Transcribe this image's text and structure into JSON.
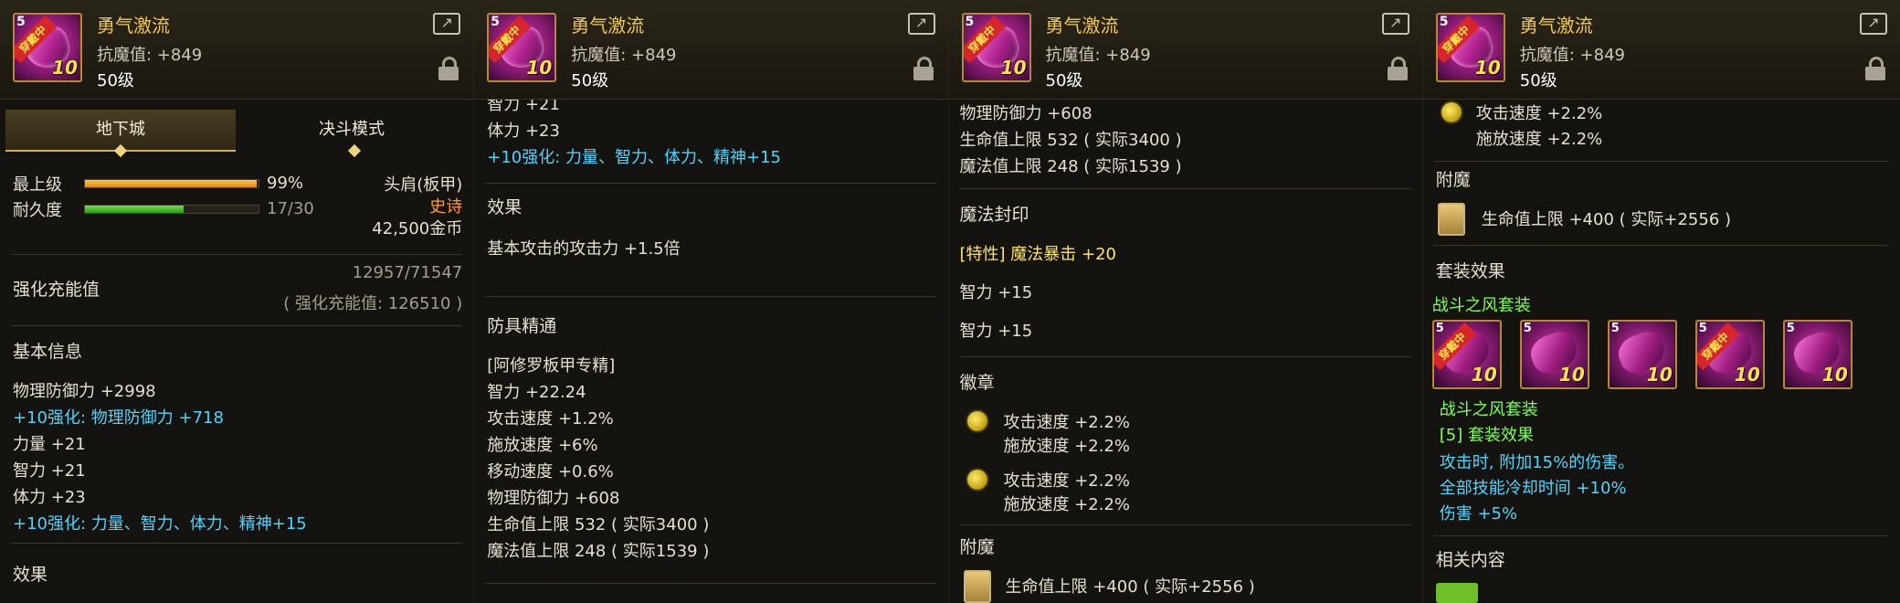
{
  "item": {
    "name": "勇气激流",
    "stat": "抗魔值: +849",
    "level": "50级",
    "icon_badge": "5",
    "icon_plus": "10",
    "wearing_ribbon": "穿戴中"
  },
  "icons": {
    "share": "share-icon",
    "lock": "lock-icon",
    "emblem": "yellow-orb-icon",
    "enchant": "gold-card-icon"
  },
  "colors": {
    "title": "#f2c94c",
    "blue_text": "#4fd4ff",
    "green_text": "#7dff5a",
    "epic": "#ff9a3c",
    "accent": "#d7b255"
  },
  "panel1": {
    "tabs": [
      "地下城",
      "决斗模式"
    ],
    "max_grade_label": "最上级",
    "max_grade_value": "99%",
    "max_grade_fill": 0.99,
    "durability_label": "耐久度",
    "durability_value": "17/30",
    "durability_fill": 0.5667,
    "slot": "头肩(板甲)",
    "rarity": "史诗",
    "price": "42,500金币",
    "charge_label": "强化充能值",
    "charge_value": "12957/71547",
    "charge_sub": "( 强化充能值: 126510 )",
    "basic_title": "基本信息",
    "lines": [
      {
        "text": "物理防御力 +2998",
        "style": "white"
      },
      {
        "text": "+10强化: 物理防御力 +718",
        "style": "blue"
      },
      {
        "text": "力量 +21",
        "style": "white"
      },
      {
        "text": "智力 +21",
        "style": "white"
      },
      {
        "text": "体力 +23",
        "style": "white"
      },
      {
        "text": "+10强化: 力量、智力、体力、精神+15",
        "style": "blue"
      }
    ],
    "effect_title": "效果"
  },
  "panel2": {
    "top_lines": [
      {
        "text": "智力 +21",
        "style": "white"
      },
      {
        "text": "体力 +23",
        "style": "white"
      },
      {
        "text": "+10强化: 力量、智力、体力、精神+15",
        "style": "blue"
      }
    ],
    "effect_title": "效果",
    "effect_text": "基本攻击的攻击力 +1.5倍",
    "mastery_title": "防具精通",
    "mastery_lines": [
      "[阿修罗板甲专精]",
      "智力 +22.24",
      "攻击速度 +1.2%",
      "施放速度 +6%",
      "移动速度 +0.6%",
      "物理防御力 +608",
      "生命值上限 532 ( 实际3400 )",
      "魔法值上限 248 ( 实际1539 )"
    ]
  },
  "panel3": {
    "top_lines": [
      "物理防御力 +608",
      "生命值上限 532 ( 实际3400 )",
      "魔法值上限 248 ( 实际1539 )"
    ],
    "seal_title": "魔法封印",
    "seal_lines": [
      {
        "text": "[特性] 魔法暴击 +20",
        "style": "yellow"
      },
      {
        "text": "智力 +15",
        "style": "white"
      },
      {
        "text": "智力 +15",
        "style": "white"
      }
    ],
    "emblem_title": "徽章",
    "emblems": [
      {
        "line1": "攻击速度 +2.2%",
        "line2": "施放速度 +2.2%"
      },
      {
        "line1": "攻击速度 +2.2%",
        "line2": "施放速度 +2.2%"
      }
    ],
    "enchant_title": "附魔",
    "enchant_text": "生命值上限 +400 ( 实际+2556 )"
  },
  "panel4": {
    "emblem": {
      "line1": "攻击速度 +2.2%",
      "line2": "施放速度 +2.2%"
    },
    "enchant_title": "附魔",
    "enchant_text": "生命值上限 +400 ( 实际+2556 )",
    "set_title": "套装效果",
    "set_name": "战斗之风套装",
    "set_items": [
      {
        "ribbon": "穿戴中"
      },
      {
        "ribbon": ""
      },
      {
        "ribbon": ""
      },
      {
        "ribbon": "穿戴中"
      },
      {
        "ribbon": ""
      }
    ],
    "set_name2": "战斗之风套装",
    "set_count": "[5] 套装效果",
    "set_effects": [
      "攻击时, 附加15%的伤害。",
      "全部技能冷却时间 +10%",
      "伤害 +5%"
    ],
    "related_title": "相关内容"
  }
}
